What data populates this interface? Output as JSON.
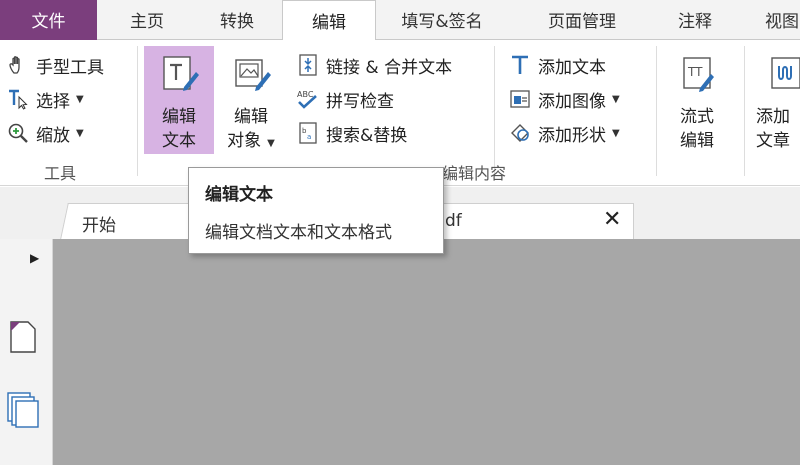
{
  "tabs": {
    "file": "文件",
    "home": "主页",
    "convert": "转换",
    "edit": "编辑",
    "fill_sign": "填写&签名",
    "page_manage": "页面管理",
    "comment": "注释",
    "view": "视图"
  },
  "ribbon": {
    "tools": {
      "hand": "手型工具",
      "select": "选择",
      "zoom": "缩放",
      "group_label": "工具"
    },
    "edit_content": {
      "edit_text_line1": "编辑",
      "edit_text_line2": "文本",
      "edit_object_line1": "编辑",
      "edit_object_line2": "对象",
      "link_merge": "链接 & 合并文本",
      "spell_check": "拼写检查",
      "search_replace": "搜索&替换",
      "add_text": "添加文本",
      "add_image": "添加图像",
      "add_shape": "添加形状",
      "flow_edit_line1": "流式",
      "flow_edit_line2": "编辑",
      "add_article_line1": "添加",
      "add_article_line2": "文章",
      "group_label": "编辑内容"
    }
  },
  "tooltip": {
    "title": "编辑文本",
    "description": "编辑文档文本和文本格式"
  },
  "document_tabs": {
    "start": "开始",
    "doc_suffix": "df"
  },
  "colors": {
    "file_tab_bg": "#7b3e7d",
    "selected_btn_bg": "#d7b3e3",
    "workarea_bg": "#a7a7a7",
    "icon_blue": "#2e6fb5"
  }
}
